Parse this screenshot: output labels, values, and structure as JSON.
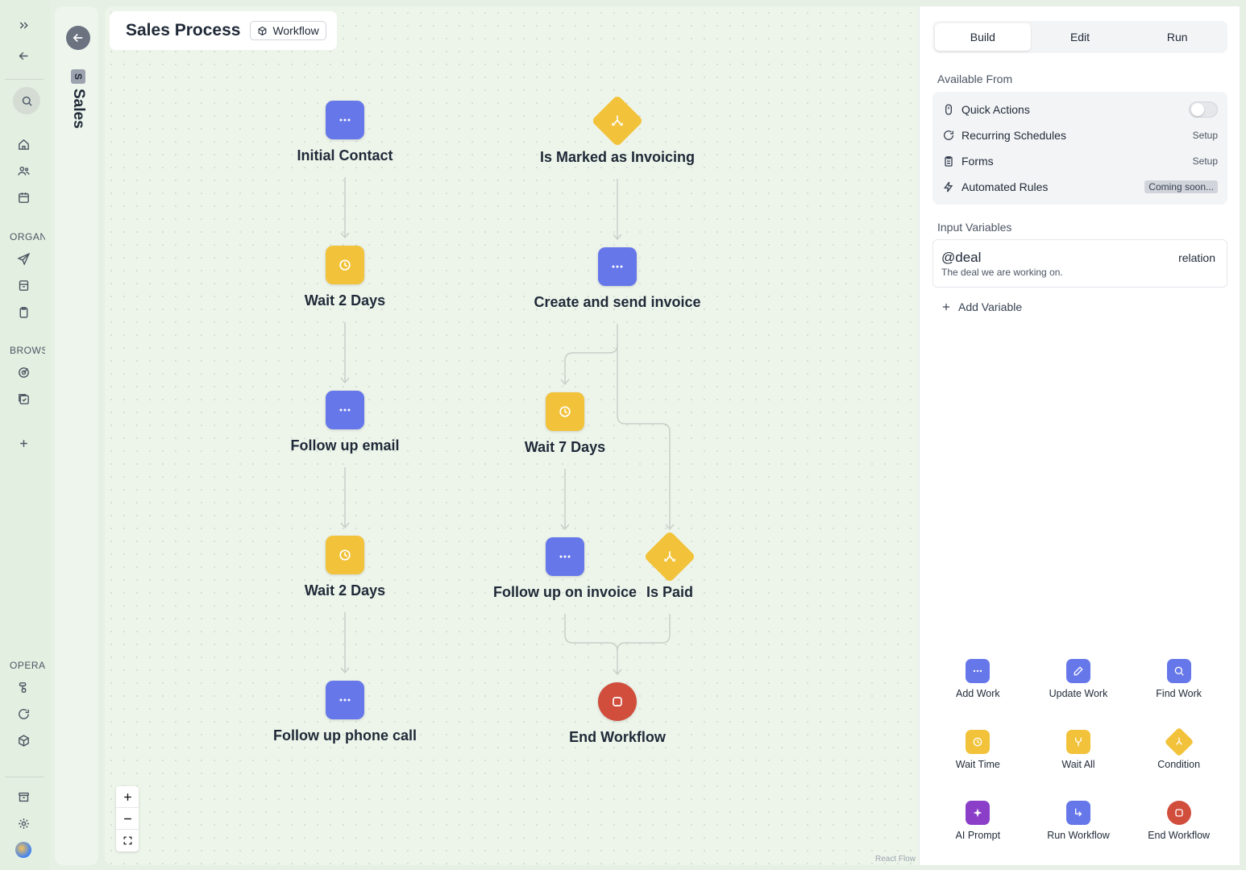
{
  "rail": {
    "sections": [
      "ORGAN",
      "BROWS",
      "OPERA"
    ]
  },
  "space": {
    "chip": "S",
    "name": "Sales"
  },
  "workflow": {
    "title": "Sales Process",
    "badge": "Workflow",
    "nodes": {
      "initial_contact": "Initial Contact",
      "wait_2_days_a": "Wait 2 Days",
      "follow_up_email": "Follow up email",
      "wait_2_days_b": "Wait 2 Days",
      "follow_up_phone_call": "Follow up phone call",
      "is_marked_invoicing": "Is Marked as Invoicing",
      "create_send_invoice": "Create and send invoice",
      "wait_7_days": "Wait 7 Days",
      "follow_up_invoice": "Follow up on invoice",
      "is_paid": "Is Paid",
      "end_workflow": "End Workflow"
    },
    "attribution": "React Flow"
  },
  "panel": {
    "tabs": [
      "Build",
      "Edit",
      "Run"
    ],
    "active_tab": "Build",
    "available_from": {
      "title": "Available From",
      "rows": [
        {
          "label": "Quick Actions",
          "icon": "mouse-icon"
        },
        {
          "label": "Recurring Schedules",
          "note": "Setup",
          "icon": "refresh-icon"
        },
        {
          "label": "Forms",
          "note": "Setup",
          "icon": "clipboard-icon"
        },
        {
          "label": "Automated Rules",
          "note": "Coming soon...",
          "icon": "bolt-icon"
        }
      ]
    },
    "input_variables": {
      "title": "Input Variables",
      "variable": {
        "name": "@deal",
        "description": "The deal we are working on.",
        "type": "relation"
      },
      "add_label": "Add Variable"
    },
    "palette": [
      {
        "label": "Add Work",
        "color": "#6677ea"
      },
      {
        "label": "Update Work",
        "color": "#6677ea"
      },
      {
        "label": "Find Work",
        "color": "#6677ea"
      },
      {
        "label": "Wait Time",
        "color": "#f2c23a"
      },
      {
        "label": "Wait All",
        "color": "#f2c23a"
      },
      {
        "label": "Condition",
        "color": "#f2c23a"
      },
      {
        "label": "AI Prompt",
        "color": "#8b3fc9"
      },
      {
        "label": "Run Workflow",
        "color": "#6677ea"
      },
      {
        "label": "End Workflow",
        "color": "#d14e3d"
      }
    ]
  }
}
